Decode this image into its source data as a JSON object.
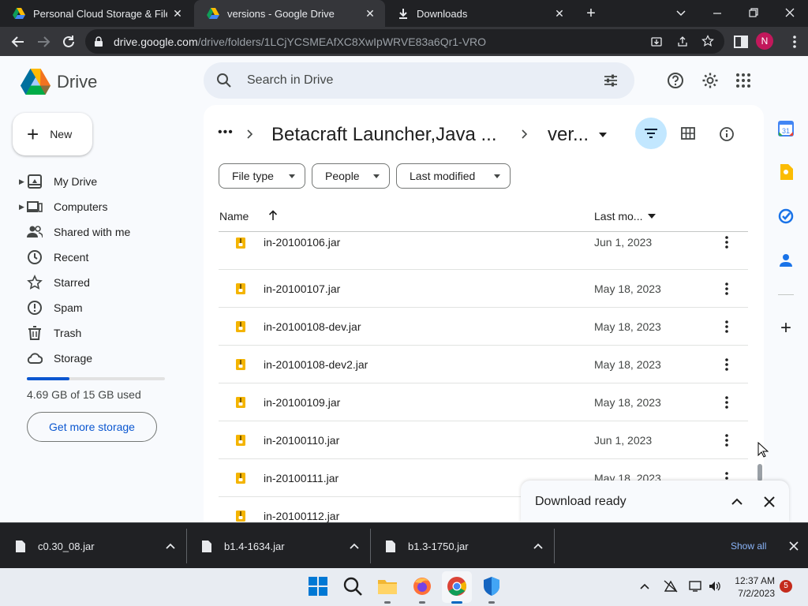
{
  "browser": {
    "tabs": [
      {
        "title": "Personal Cloud Storage & File Sh",
        "active": false
      },
      {
        "title": "versions - Google Drive",
        "active": true
      },
      {
        "title": "Downloads",
        "active": false
      }
    ],
    "url_host": "drive.google.com",
    "url_path": "/drive/folders/1LCjYCSMEAfXC8XwIpWRVE83a6Qr1-VRO",
    "profile_initial": "N"
  },
  "drive": {
    "logo_text": "Drive",
    "search_placeholder": "Search in Drive",
    "account_initial": "N",
    "new_label": "New",
    "nav": [
      {
        "label": "My Drive",
        "icon": "my-drive-icon",
        "caret": true
      },
      {
        "label": "Computers",
        "icon": "computers-icon",
        "caret": true
      },
      {
        "label": "Shared with me",
        "icon": "shared-icon",
        "caret": false
      },
      {
        "label": "Recent",
        "icon": "clock-icon",
        "caret": false
      },
      {
        "label": "Starred",
        "icon": "star-icon",
        "caret": false
      },
      {
        "label": "Spam",
        "icon": "spam-icon",
        "caret": false
      },
      {
        "label": "Trash",
        "icon": "trash-icon",
        "caret": false
      },
      {
        "label": "Storage",
        "icon": "cloud-icon",
        "caret": false
      }
    ],
    "storage": {
      "used_text": "4.69 GB of 15 GB used",
      "fraction": 0.31
    },
    "get_more_storage": "Get more storage",
    "breadcrumb": {
      "more": "•••",
      "parent": "Betacraft Launcher,Java ...",
      "current": "ver..."
    },
    "filters": [
      "File type",
      "People",
      "Last modified"
    ],
    "columns": {
      "name": "Name",
      "last_modified": "Last mo..."
    },
    "files": [
      {
        "name": "in-20100106.jar",
        "date": "Jun 1, 2023"
      },
      {
        "name": "in-20100107.jar",
        "date": "May 18, 2023"
      },
      {
        "name": "in-20100108-dev.jar",
        "date": "May 18, 2023"
      },
      {
        "name": "in-20100108-dev2.jar",
        "date": "May 18, 2023"
      },
      {
        "name": "in-20100109.jar",
        "date": "May 18, 2023"
      },
      {
        "name": "in-20100110.jar",
        "date": "Jun 1, 2023"
      },
      {
        "name": "in-20100111.jar",
        "date": "May 18, 2023"
      },
      {
        "name": "in-20100112.jar",
        "date": ""
      }
    ],
    "download_ready": "Download ready"
  },
  "shelf": {
    "items": [
      "c0.30_08.jar",
      "b1.4-1634.jar",
      "b1.3-1750.jar"
    ],
    "show_all": "Show all"
  },
  "taskbar": {
    "time": "12:37 AM",
    "date": "7/2/2023",
    "notifications": "5"
  },
  "colors": {
    "accent": "#0b57d0",
    "avatar": "#c2185b",
    "selected_view": "#c2e7ff"
  }
}
